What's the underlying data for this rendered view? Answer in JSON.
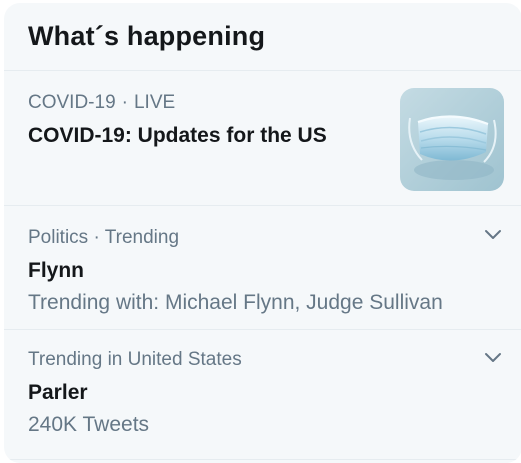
{
  "header": {
    "title": "What´s happening"
  },
  "trends": [
    {
      "context": "COVID-19",
      "separator": "·",
      "status": "LIVE",
      "title": "COVID-19: Updates for the US",
      "thumbnail": "face-mask-photo"
    },
    {
      "context": "Politics · Trending",
      "title": "Flynn",
      "subtitle": "Trending with: Michael Flynn, Judge Sullivan",
      "menu_icon": "chevron-down-icon"
    },
    {
      "context": "Trending in United States",
      "title": "Parler",
      "subtitle": "240K Tweets",
      "menu_icon": "chevron-down-icon"
    }
  ],
  "colors": {
    "panel_bg": "#f5f8fa",
    "primary_text": "#14171a",
    "secondary_text": "#657786",
    "divider": "#e6ecf0",
    "accent": "#1da1f2"
  }
}
